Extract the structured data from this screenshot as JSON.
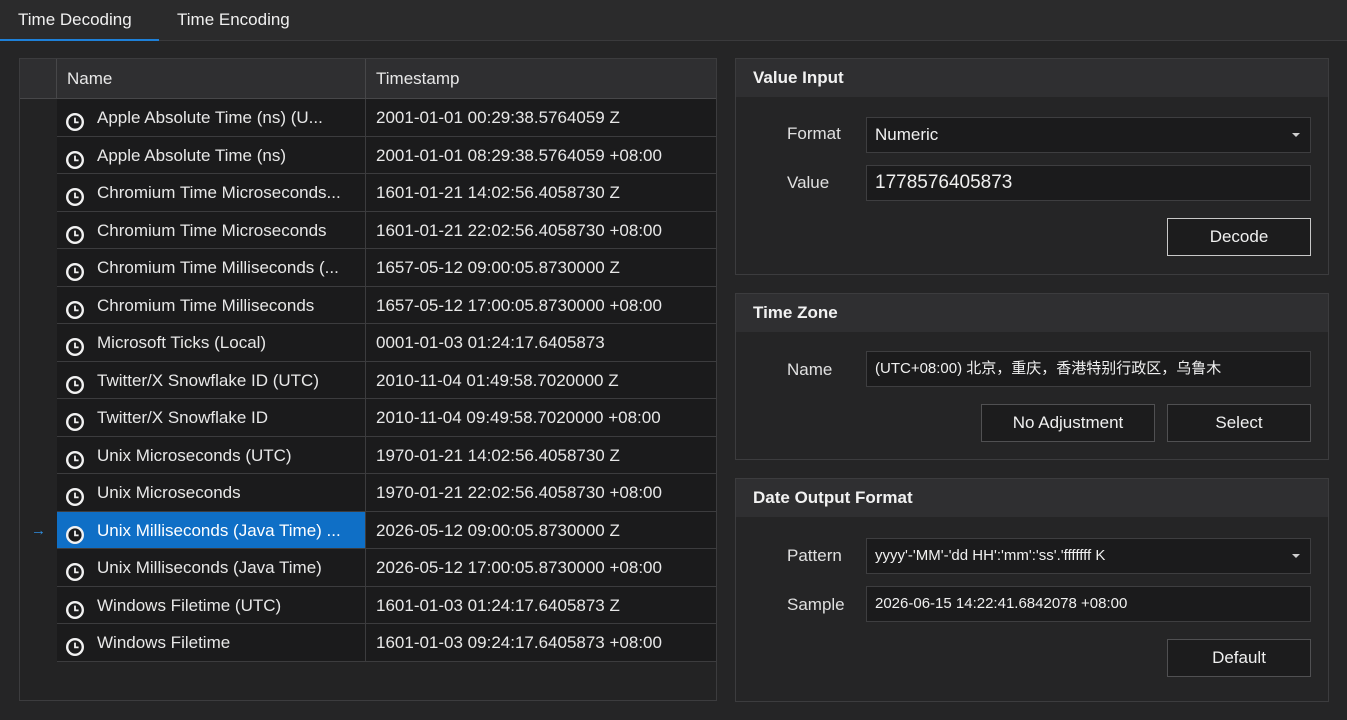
{
  "tabs": [
    {
      "label": "Time Decoding",
      "active": true
    },
    {
      "label": "Time Encoding",
      "active": false
    }
  ],
  "grid": {
    "columns": [
      "Name",
      "Timestamp"
    ],
    "selected_index": 11,
    "current_row_marker": "→",
    "rows": [
      {
        "name": "Apple Absolute Time (ns) (U...",
        "timestamp": "2001-01-01 00:29:38.5764059 Z"
      },
      {
        "name": "Apple Absolute Time (ns)",
        "timestamp": "2001-01-01 08:29:38.5764059 +08:00"
      },
      {
        "name": "Chromium Time Microseconds...",
        "timestamp": "1601-01-21 14:02:56.4058730 Z"
      },
      {
        "name": "Chromium Time Microseconds",
        "timestamp": "1601-01-21 22:02:56.4058730 +08:00"
      },
      {
        "name": "Chromium Time Milliseconds (...",
        "timestamp": "1657-05-12 09:00:05.8730000 Z"
      },
      {
        "name": "Chromium Time Milliseconds",
        "timestamp": "1657-05-12 17:00:05.8730000 +08:00"
      },
      {
        "name": "Microsoft Ticks (Local)",
        "timestamp": "0001-01-03 01:24:17.6405873"
      },
      {
        "name": "Twitter/X Snowflake ID (UTC)",
        "timestamp": "2010-11-04 01:49:58.7020000 Z"
      },
      {
        "name": "Twitter/X Snowflake ID",
        "timestamp": "2010-11-04 09:49:58.7020000 +08:00"
      },
      {
        "name": "Unix Microseconds (UTC)",
        "timestamp": "1970-01-21 14:02:56.4058730 Z"
      },
      {
        "name": "Unix Microseconds",
        "timestamp": "1970-01-21 22:02:56.4058730 +08:00"
      },
      {
        "name": "Unix Milliseconds (Java Time) ...",
        "timestamp": "2026-05-12 09:00:05.8730000 Z"
      },
      {
        "name": "Unix Milliseconds (Java Time)",
        "timestamp": "2026-05-12 17:00:05.8730000 +08:00"
      },
      {
        "name": "Windows Filetime (UTC)",
        "timestamp": "1601-01-03 01:24:17.6405873 Z"
      },
      {
        "name": "Windows Filetime",
        "timestamp": "1601-01-03 09:24:17.6405873 +08:00"
      }
    ]
  },
  "value_input": {
    "title": "Value Input",
    "format_label": "Format",
    "format_value": "Numeric",
    "value_label": "Value",
    "value_value": "1778576405873",
    "decode_label": "Decode"
  },
  "time_zone": {
    "title": "Time Zone",
    "name_label": "Name",
    "name_value": "(UTC+08:00) 北京，重庆，香港特别行政区，乌鲁木",
    "no_adjustment_label": "No Adjustment",
    "select_label": "Select"
  },
  "date_output": {
    "title": "Date Output Format",
    "pattern_label": "Pattern",
    "pattern_value": "yyyy'-'MM'-'dd HH':'mm':'ss'.'fffffff K",
    "sample_label": "Sample",
    "sample_value": "2026-06-15 14:22:41.6842078 +08:00",
    "default_label": "Default"
  },
  "colors": {
    "accent": "#1e80d8",
    "selection": "#0f6fc6",
    "background": "#252526"
  },
  "icons": {
    "row_icon": "clock-icon",
    "dropdown": "chevron-down-icon"
  }
}
